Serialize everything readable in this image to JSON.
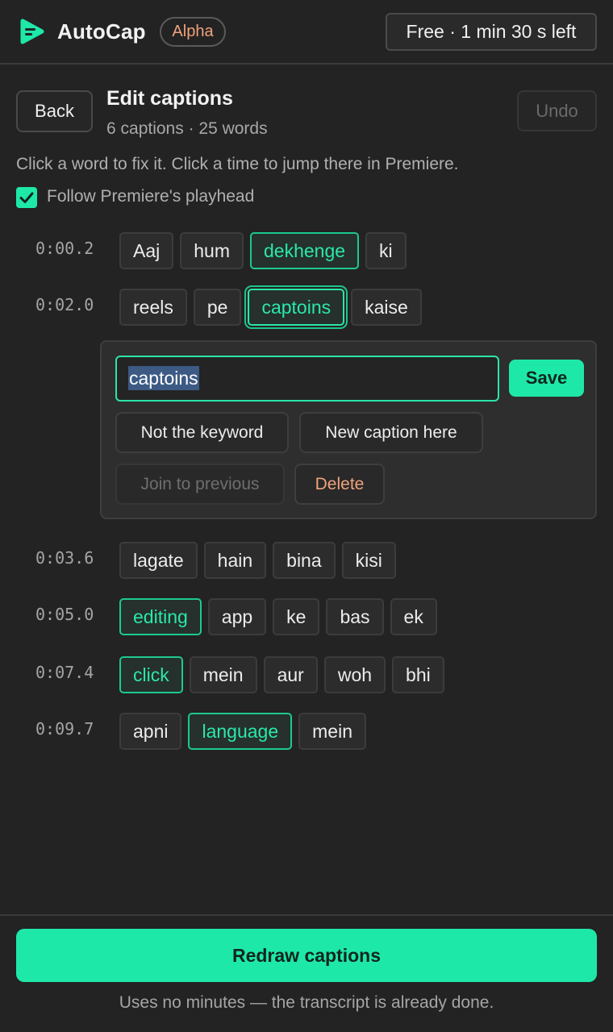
{
  "header": {
    "app_title": "AutoCap",
    "badge": "Alpha",
    "plan": "Free · 1 min 30 s left",
    "logo_icon": "autocap-logo-icon"
  },
  "toolbar": {
    "back_label": "Back",
    "title": "Edit captions",
    "subtitle": "6 captions · 25 words",
    "undo_label": "Undo"
  },
  "hint": "Click a word to fix it. Click a time to jump there in Premiere.",
  "follow": {
    "label": "Follow Premiere's playhead",
    "checked": true
  },
  "captions": [
    {
      "time": "0:00.2",
      "words": [
        "Aaj",
        "hum",
        "dekhenge",
        "ki"
      ]
    },
    {
      "time": "0:02.0",
      "words": [
        "reels",
        "pe",
        "captoins",
        "kaise"
      ]
    },
    {
      "time": "0:03.6",
      "words": [
        "lagate",
        "hain",
        "bina",
        "kisi"
      ]
    },
    {
      "time": "0:05.0",
      "words": [
        "editing",
        "app",
        "ke",
        "bas",
        "ek"
      ]
    },
    {
      "time": "0:07.4",
      "words": [
        "click",
        "mein",
        "aur",
        "woh",
        "bhi"
      ]
    },
    {
      "time": "0:09.7",
      "words": [
        "apni",
        "language",
        "mein"
      ]
    }
  ],
  "editor": {
    "value": "captoins",
    "save_label": "Save",
    "not_keyword_label": "Not the keyword",
    "new_caption_label": "New caption here",
    "join_previous_label": "Join to previous",
    "delete_label": "Delete"
  },
  "footer": {
    "redraw_label": "Redraw captions",
    "note": "Uses no minutes — the transcript is already done."
  },
  "colors": {
    "accent": "#1ee8a8",
    "background": "#232323",
    "badge_text": "#f0a27c",
    "danger": "#f0a27c"
  }
}
